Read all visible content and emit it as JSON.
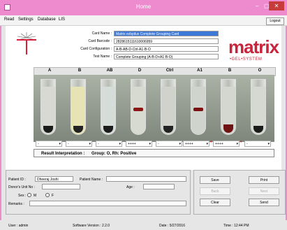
{
  "window": {
    "title": "Home",
    "minimize": "–",
    "close": "✕"
  },
  "menu": [
    "Read",
    "Settings",
    "Database",
    "LIS"
  ],
  "logout_label": "Logout",
  "card": {
    "name_label": "Card Name :",
    "name_value": "Matrix ezbpilux Complete Grouping Card",
    "barcode_label": "Card Barcode :",
    "barcode_value": "2828615111610006959",
    "config_label": "Card Configuration :",
    "config_value": "A-B-AB-D-Ctrl-A1-B-O",
    "test_label": "Test Name :",
    "test_value": "Complete Grouping (A-B-D+A1-B-O)"
  },
  "brand": {
    "name": "matrix",
    "tagline": "•GEL•SYSTEM"
  },
  "columns": [
    "A",
    "B",
    "AB",
    "D",
    "Ctrl",
    "A1",
    "B",
    "O"
  ],
  "tube_colors": [
    "#d7d9d2",
    "#e6e3b4",
    "#d6dcd7",
    "#d7dad1",
    "#cfd3cb",
    "#cfd4cc",
    "#d3d7cf",
    "#d6d9d2"
  ],
  "tube_blob_colors": [
    "#1a1a1a",
    "#222",
    "#1b1b1b",
    "#8a1616",
    "#222",
    "#7a1010",
    "#6e1212",
    "#1a1a1a"
  ],
  "controls": [
    "-",
    "-",
    "-",
    "++++",
    "-",
    "++++",
    "++++",
    "-"
  ],
  "result": {
    "label": "Result Interpretation :",
    "value": "Group: O, Rh: Positive"
  },
  "patient": {
    "id_label": "Patient ID :",
    "id_value": "Dheeraj Joshi",
    "name_label": "Patient Name :",
    "name_value": "",
    "donor_label": "Donor's Unit No :",
    "age_label": "Age :",
    "sex_label": "Sex :",
    "sex_m": "M",
    "sex_f": "F",
    "remarks_label": "Remarks :"
  },
  "buttons": {
    "save": "Save",
    "print": "Print",
    "back": "Back",
    "next": "Next",
    "clear": "Clear",
    "send": "Send"
  },
  "status": {
    "user": "User :  admin",
    "version": "Software Version :   2.2.0",
    "date": "Date :  5/27/2016",
    "time": "Time :  12:44 PM"
  }
}
